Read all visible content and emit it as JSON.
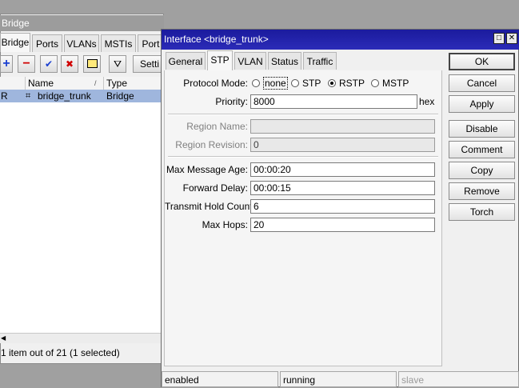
{
  "bridge_window": {
    "title": "Bridge",
    "tabs": [
      "Bridge",
      "Ports",
      "VLANs",
      "MSTIs",
      "Port"
    ],
    "settings_label": "Setti",
    "columns": {
      "name": "Name",
      "type": "Type"
    },
    "rows": [
      {
        "flag": "R",
        "name": "bridge_trunk",
        "type": "Bridge"
      }
    ],
    "status": "1 item out of 21 (1 selected)"
  },
  "dialog": {
    "title": "Interface <bridge_trunk>",
    "tabs": [
      "General",
      "STP",
      "VLAN",
      "Status",
      "Traffic"
    ],
    "active_tab": "STP",
    "protocol_mode": {
      "label": "Protocol Mode:",
      "options": [
        "none",
        "STP",
        "RSTP",
        "MSTP"
      ],
      "selected": "RSTP"
    },
    "priority": {
      "label": "Priority:",
      "value": "8000",
      "suffix": "hex"
    },
    "region_name": {
      "label": "Region Name:",
      "value": ""
    },
    "region_revision": {
      "label": "Region Revision:",
      "value": "0"
    },
    "max_message_age": {
      "label": "Max Message Age:",
      "value": "00:00:20"
    },
    "forward_delay": {
      "label": "Forward Delay:",
      "value": "00:00:15"
    },
    "transmit_hold_count": {
      "label": "Transmit Hold Count:",
      "value": "6"
    },
    "max_hops": {
      "label": "Max Hops:",
      "value": "20"
    },
    "buttons": [
      "OK",
      "Cancel",
      "Apply",
      "Disable",
      "Comment",
      "Copy",
      "Remove",
      "Torch"
    ],
    "status_bar": [
      "enabled",
      "running",
      "slave"
    ]
  }
}
